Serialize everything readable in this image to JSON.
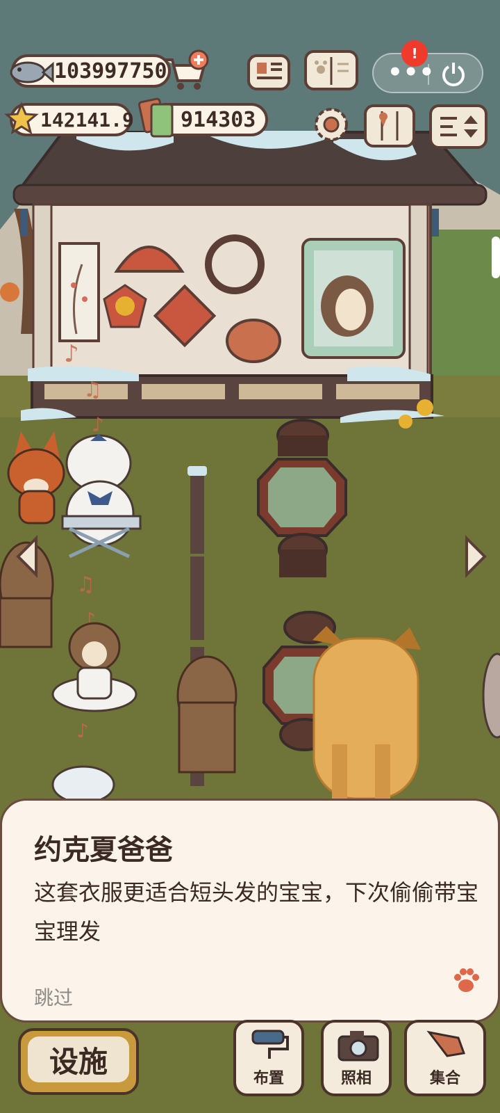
{
  "hud": {
    "fish_count": "103997750",
    "star_count": "142141.9",
    "ticket_count": "914303"
  },
  "miniprogram": {
    "badge": "!"
  },
  "dialog": {
    "speaker": "约克夏爸爸",
    "text": "这套衣服更适合短头发的宝宝，下次偷偷带宝宝理发",
    "skip_label": "跳过"
  },
  "toolbar": {
    "facility_label": "设施",
    "layout_label": "布置",
    "photo_label": "照相",
    "gather_label": "集合"
  },
  "icons": {
    "fish": "fish-icon",
    "cart": "shop-cart-plus-icon",
    "star": "star-icon",
    "ticket": "ticket-icon",
    "newspaper": "newspaper-icon",
    "album": "paw-album-icon",
    "gear": "gear-icon",
    "map": "map-icon",
    "sort": "sort-icon",
    "more": "more-dots-icon",
    "power": "power-icon",
    "paw": "paw-icon"
  },
  "colors": {
    "sky": "#5e7a78",
    "grass": "#6f7438",
    "dialog_bg": "#fcf4ea",
    "accent_red": "#ef3b2c",
    "facility_gold": "#c99a3d"
  }
}
